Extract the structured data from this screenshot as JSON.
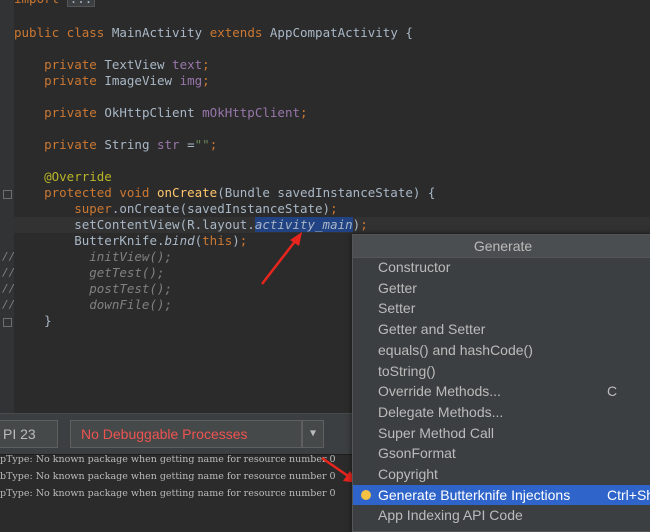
{
  "editor": {
    "lines": [
      {
        "segs": [
          {
            "t": "import ",
            "c": "kw"
          },
          {
            "t": "...",
            "c": "fold-text"
          }
        ]
      },
      {
        "segs": [
          {
            "t": "public class ",
            "c": "kw"
          },
          {
            "t": "MainActivity "
          },
          {
            "t": "extends ",
            "c": "kw"
          },
          {
            "t": "AppCompatActivity {"
          }
        ]
      },
      {
        "segs": []
      },
      {
        "segs": [
          {
            "t": "    private ",
            "c": "kw"
          },
          {
            "t": "TextView "
          },
          {
            "t": "text",
            "c": "fld"
          },
          {
            "t": ";",
            "c": "kw"
          }
        ]
      },
      {
        "segs": [
          {
            "t": "    private ",
            "c": "kw"
          },
          {
            "t": "ImageView "
          },
          {
            "t": "img",
            "c": "fld"
          },
          {
            "t": ";",
            "c": "kw"
          }
        ]
      },
      {
        "segs": []
      },
      {
        "segs": [
          {
            "t": "    private ",
            "c": "kw"
          },
          {
            "t": "OkHttpClient "
          },
          {
            "t": "mOkHttpClient",
            "c": "fld"
          },
          {
            "t": ";",
            "c": "kw"
          }
        ]
      },
      {
        "segs": []
      },
      {
        "segs": [
          {
            "t": "    private ",
            "c": "kw"
          },
          {
            "t": "String "
          },
          {
            "t": "str ",
            "c": "fld"
          },
          {
            "t": "="
          },
          {
            "t": "\"\"",
            "c": "str"
          },
          {
            "t": ";",
            "c": "kw"
          }
        ]
      },
      {
        "segs": []
      },
      {
        "segs": [
          {
            "t": "    @Override",
            "c": "anno"
          }
        ]
      },
      {
        "segs": [
          {
            "t": "    protected void ",
            "c": "kw"
          },
          {
            "t": "onCreate",
            "c": "meth"
          },
          {
            "t": "(Bundle savedInstanceState) {"
          }
        ]
      },
      {
        "segs": [
          {
            "t": "        super",
            "c": "kw"
          },
          {
            "t": ".onCreate(savedInstanceState)"
          },
          {
            "t": ";",
            "c": "kw"
          }
        ]
      },
      {
        "segs": [
          {
            "t": "        setContentView(R.layout."
          },
          {
            "t": "activity_main",
            "c": "sel"
          },
          {
            "t": ")"
          },
          {
            "t": ";",
            "c": "kw"
          }
        ]
      },
      {
        "segs": [
          {
            "t": "        ButterKnife."
          },
          {
            "t": "bind",
            "c": "itl"
          },
          {
            "t": "("
          },
          {
            "t": "this",
            "c": "kw"
          },
          {
            "t": ")"
          },
          {
            "t": ";",
            "c": "kw"
          }
        ]
      },
      {
        "segs": [
          {
            "t": "          initView();",
            "c": "cmt"
          }
        ]
      },
      {
        "segs": [
          {
            "t": "          getTest();",
            "c": "cmt"
          }
        ]
      },
      {
        "segs": [
          {
            "t": "          postTest();",
            "c": "cmt"
          }
        ]
      },
      {
        "segs": [
          {
            "t": "          downFile();",
            "c": "cmt"
          }
        ]
      },
      {
        "segs": [
          {
            "t": "    }"
          }
        ]
      }
    ],
    "gutter_comments": [
      "//",
      "//",
      "//",
      "//"
    ]
  },
  "toolbar": {
    "api_level": "PI 23",
    "process_label": "No Debuggable Processes",
    "dropdown_glyph": "▼"
  },
  "log": [
    "pType: No known package when getting name for resource number 0",
    "bType: No known package when getting name for resource number 0",
    "pType: No known package when getting name for resource number 0"
  ],
  "popup": {
    "title": "Generate",
    "items": [
      {
        "label": "Constructor",
        "shortcut": ""
      },
      {
        "label": "Getter",
        "shortcut": ""
      },
      {
        "label": "Setter",
        "shortcut": ""
      },
      {
        "label": "Getter and Setter",
        "shortcut": ""
      },
      {
        "label": "equals() and hashCode()",
        "shortcut": ""
      },
      {
        "label": "toString()",
        "shortcut": ""
      },
      {
        "label": "Override Methods...",
        "shortcut": "C"
      },
      {
        "label": "Delegate Methods...",
        "shortcut": ""
      },
      {
        "label": "Super Method Call",
        "shortcut": ""
      },
      {
        "label": "GsonFormat",
        "shortcut": ""
      },
      {
        "label": "Copyright",
        "shortcut": ""
      },
      {
        "label": "Generate Butterknife Injections",
        "shortcut": "Ctrl+Sh",
        "active": true,
        "icon": "lightbulb-icon"
      },
      {
        "label": "App Indexing API Code",
        "shortcut": ""
      }
    ]
  },
  "colors": {
    "arrow": "#e8251d",
    "selection": "#2f65ca"
  }
}
